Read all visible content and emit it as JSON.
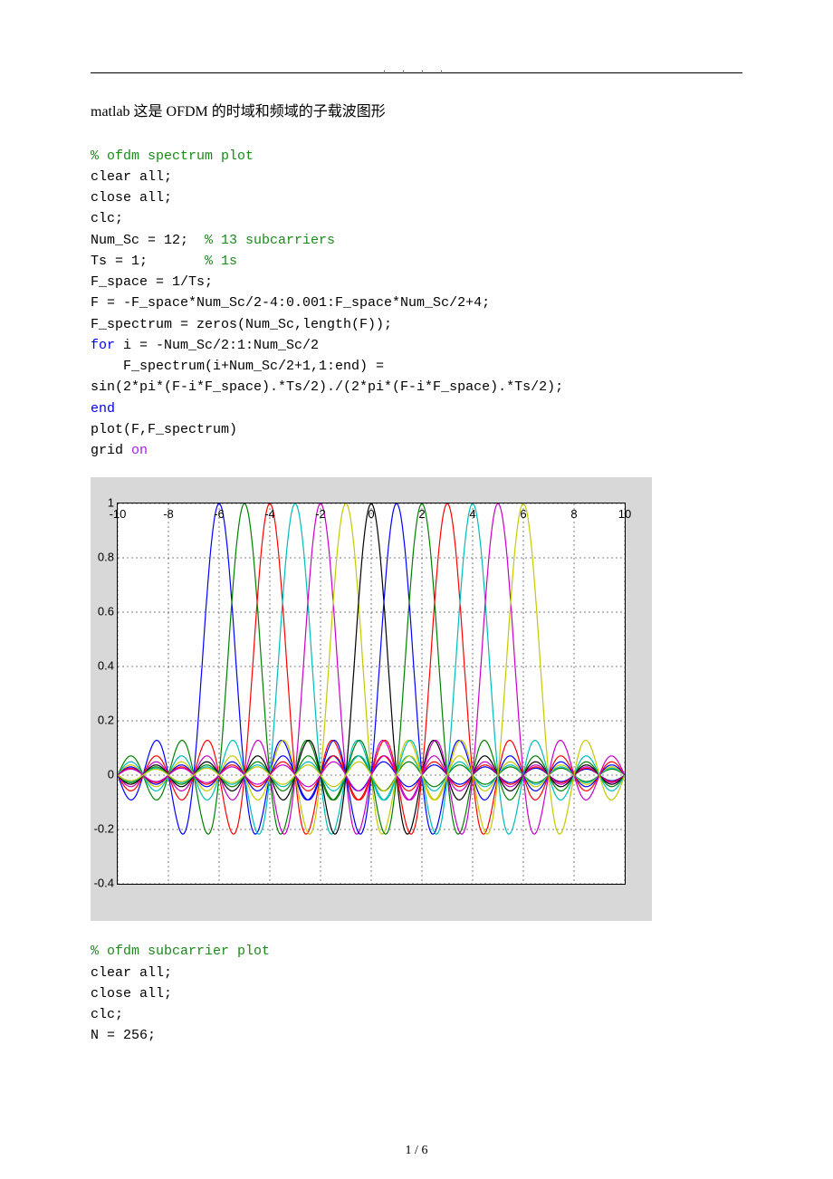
{
  "header": {
    "dots": ". . . ."
  },
  "title": "matlab 这是 OFDM 的时域和频域的子载波图形",
  "code1": {
    "l1": "% ofdm spectrum plot",
    "l2": "clear all;",
    "l3": "close all;",
    "l4": "clc;",
    "l5a": "Num_Sc = 12;  ",
    "l5b": "% 13 subcarriers",
    "l6a": "Ts = 1;       ",
    "l6b": "% 1s",
    "l7": "F_space = 1/Ts;",
    "l8": "F = -F_space*Num_Sc/2-4:0.001:F_space*Num_Sc/2+4;",
    "l9": "F_spectrum = zeros(Num_Sc,length(F));",
    "l10a": "for",
    "l10b": " i = -Num_Sc/2:1:Num_Sc/2",
    "l11": "    F_spectrum(i+Num_Sc/2+1,1:end) =",
    "l12": "sin(2*pi*(F-i*F_space).*Ts/2)./(2*pi*(F-i*F_space).*Ts/2);",
    "l13": "end",
    "l14": "plot(F,F_spectrum)",
    "l15a": "grid ",
    "l15b": "on"
  },
  "code2": {
    "l1": "% ofdm subcarrier plot",
    "l2": "clear all;",
    "l3": "close all;",
    "l4": "clc;",
    "l5": "N = 256;"
  },
  "chart_data": {
    "type": "line",
    "title": "",
    "xlabel": "",
    "ylabel": "",
    "xlim": [
      -10,
      10
    ],
    "ylim": [
      -0.4,
      1
    ],
    "xticks": [
      -10,
      -8,
      -6,
      -4,
      -2,
      0,
      2,
      4,
      6,
      8,
      10
    ],
    "yticks": [
      -0.4,
      -0.2,
      0,
      0.2,
      0.4,
      0.6,
      0.8,
      1
    ],
    "grid": true,
    "description": "13 sinc curves centered at integers -6..6, amplitude 1, width Ts=1 (OFDM subcarrier spectra)",
    "series_centers": [
      -6,
      -5,
      -4,
      -3,
      -2,
      -1,
      0,
      1,
      2,
      3,
      4,
      5,
      6
    ],
    "colors": [
      "#0000ff",
      "#008000",
      "#ff0000",
      "#00bcbc",
      "#c800c8",
      "#c8c800",
      "#000000",
      "#0000ff",
      "#008000",
      "#ff0000",
      "#00bcbc",
      "#c800c8",
      "#c8c800"
    ]
  },
  "footer": {
    "page_number": "1 / 6"
  }
}
